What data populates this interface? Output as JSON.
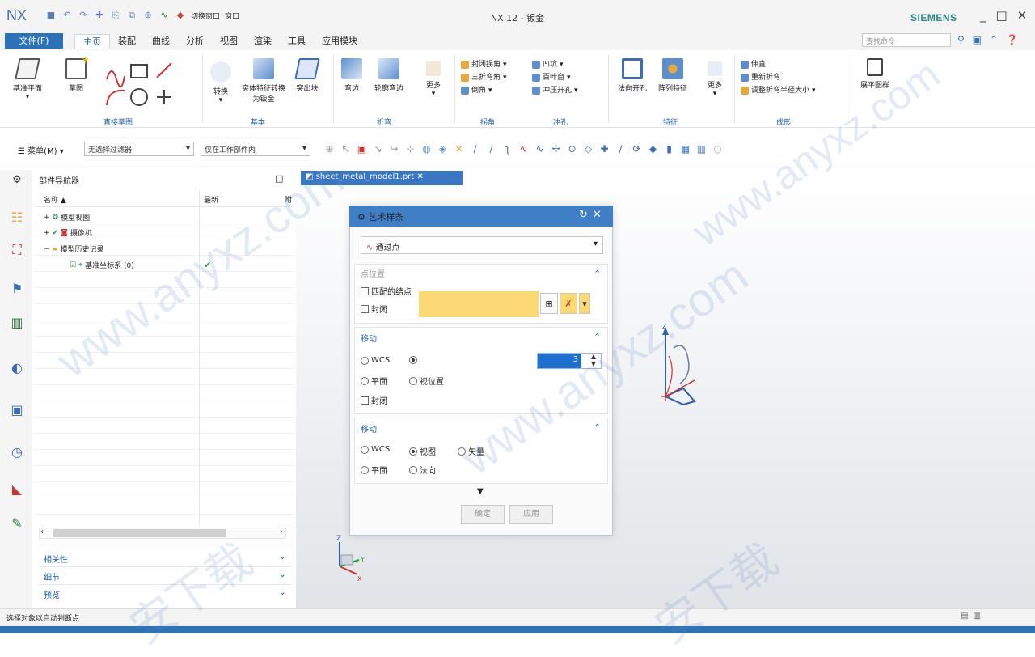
{
  "app": {
    "logo": "NX",
    "window_title": "NX 12 - 钣金",
    "brand": "SIEMENS",
    "quick_access": [
      "■",
      "↶",
      "↷",
      "✚",
      "⎘",
      "⧉",
      "⊕",
      "∿",
      "◆",
      "切换窗口",
      "窗口"
    ],
    "window_controls": [
      "_",
      "□",
      "✕"
    ]
  },
  "menubar": {
    "file": "文件(F)",
    "tabs": [
      "主页",
      "装配",
      "曲线",
      "分析",
      "视图",
      "渲染",
      "工具",
      "应用模块"
    ],
    "active_tab": "主页",
    "search_placeholder": "查找命令"
  },
  "ribbon": {
    "buttons": {
      "datum_plane": "基准平面",
      "sketch": "草图",
      "convert": "转换",
      "solid_to_sheet": "实体特征转换为钣金",
      "tab": "突出块",
      "bend": "弯边",
      "contour_flange": "轮廓弯边",
      "more1": "更多",
      "normal_cutout": "法向开孔",
      "pattern_feature": "阵列特征",
      "more2": "更多",
      "flat_pattern": "展平图样"
    },
    "list_bend": [
      "封闭拐角",
      "三折弯角",
      "倒角"
    ],
    "list_punch": [
      "凹坑",
      "百叶窗",
      "冲压开孔"
    ],
    "list_form": [
      "伸直",
      "重新折弯",
      "调整折弯半径大小"
    ],
    "groups": [
      "直接草图",
      "基本",
      "折弯",
      "拐角",
      "冲孔",
      "特征",
      "成形"
    ]
  },
  "toolbar2": {
    "menu_label": "菜单(M)",
    "filter": "无选择过滤器",
    "scope": "仅在工作部件内"
  },
  "navigator": {
    "title": "部件导航器",
    "col_name": "名称",
    "col_new": "最新",
    "col_more": "附",
    "items": [
      {
        "label": "模型视图",
        "expand": "+"
      },
      {
        "label": "摄像机",
        "expand": "+"
      },
      {
        "label": "模型历史记录",
        "expand": "−"
      },
      {
        "label": "基准坐标系 (0)",
        "check": "✔"
      }
    ],
    "panels": [
      "相关性",
      "细节",
      "预览"
    ]
  },
  "doc_tab": "sheet_metal_model1.prt",
  "dialog": {
    "title": "艺术样条",
    "type_value": "通过点",
    "section1_header": "点位置",
    "section1_options": [
      "匹配的结点",
      "封闭"
    ],
    "section2_header": "移动",
    "section2_row1": [
      "WCS"
    ],
    "section2_row2": [
      "平面",
      "视位置"
    ],
    "section2_check": "封闭",
    "spin_value": "3",
    "section3_header": "移动",
    "section3_row1": [
      "WCS",
      "视图",
      "矢量"
    ],
    "section3_row2": [
      "平面",
      "法向"
    ],
    "ok": "确定",
    "apply": "应用"
  },
  "status": {
    "text": "选择对象以自动判断点"
  },
  "watermark": "www.anyxz.com",
  "watermark_cn": "安下载"
}
